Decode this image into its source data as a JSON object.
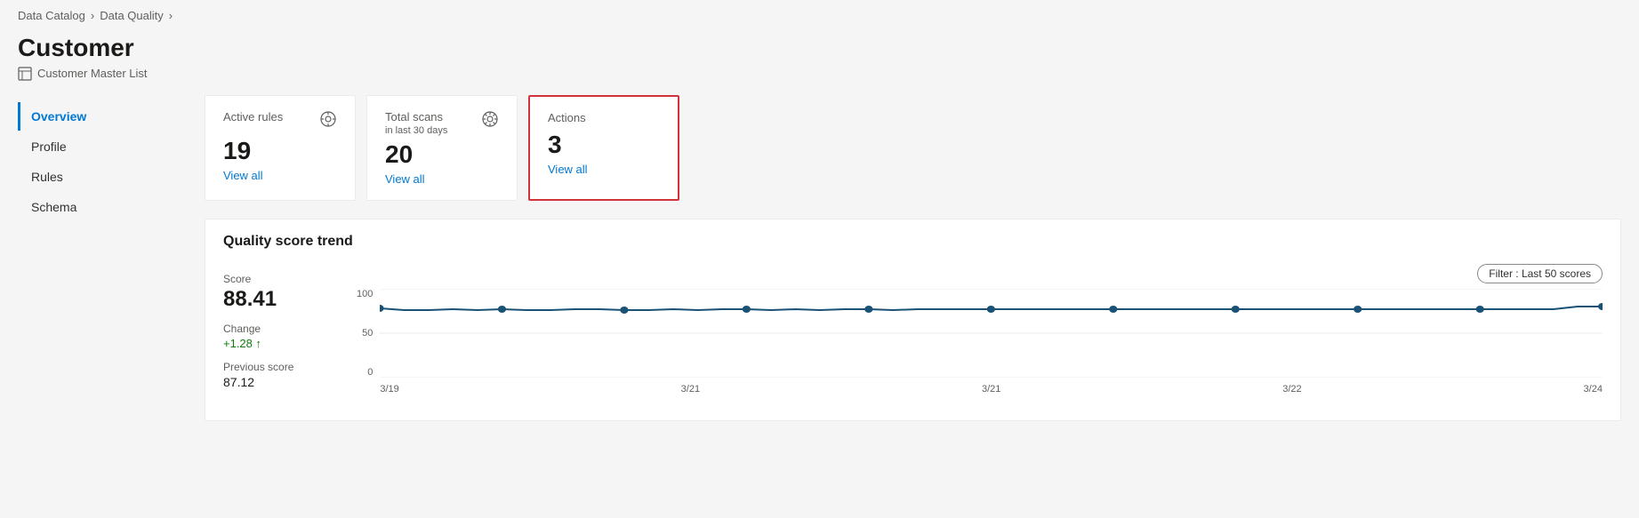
{
  "breadcrumb": {
    "items": [
      "Data Catalog",
      "Data Quality"
    ],
    "separators": [
      ">",
      ">"
    ]
  },
  "page": {
    "title": "Customer",
    "subtitle": "Customer Master List",
    "subtitle_icon": "table-icon"
  },
  "nav": {
    "items": [
      {
        "label": "Overview",
        "active": true
      },
      {
        "label": "Profile",
        "active": false
      },
      {
        "label": "Rules",
        "active": false
      },
      {
        "label": "Schema",
        "active": false
      }
    ]
  },
  "cards": [
    {
      "id": "active-rules",
      "title": "Active rules",
      "subtitle": "",
      "value": "19",
      "link_text": "View all",
      "highlighted": false,
      "has_icon": true
    },
    {
      "id": "total-scans",
      "title": "Total scans",
      "subtitle": "in last 30 days",
      "value": "20",
      "link_text": "View all",
      "highlighted": false,
      "has_icon": true
    },
    {
      "id": "actions",
      "title": "Actions",
      "subtitle": "",
      "value": "3",
      "link_text": "View all",
      "highlighted": true,
      "has_icon": false
    }
  ],
  "chart": {
    "title": "Quality score trend",
    "score_label": "Score",
    "score_value": "88.41",
    "change_label": "Change",
    "change_value": "+1.28 ↑",
    "prev_score_label": "Previous score",
    "prev_score_value": "87.12",
    "filter_label": "Filter : Last 50 scores",
    "y_axis": [
      "100",
      "50",
      "0"
    ],
    "x_axis": [
      "3/19",
      "3/21",
      "3/21",
      "3/22",
      "3/24"
    ],
    "data_points": [
      78,
      76,
      76,
      77,
      76,
      77,
      76,
      76,
      77,
      77,
      76,
      76,
      77,
      76,
      77,
      77,
      76,
      77,
      76,
      77,
      77,
      76,
      77,
      77,
      77,
      77,
      77,
      77,
      77,
      77,
      77,
      77,
      77,
      77,
      77,
      77,
      77,
      77,
      77,
      77,
      77,
      77,
      77,
      77,
      77,
      77,
      77,
      77,
      77,
      80
    ]
  }
}
